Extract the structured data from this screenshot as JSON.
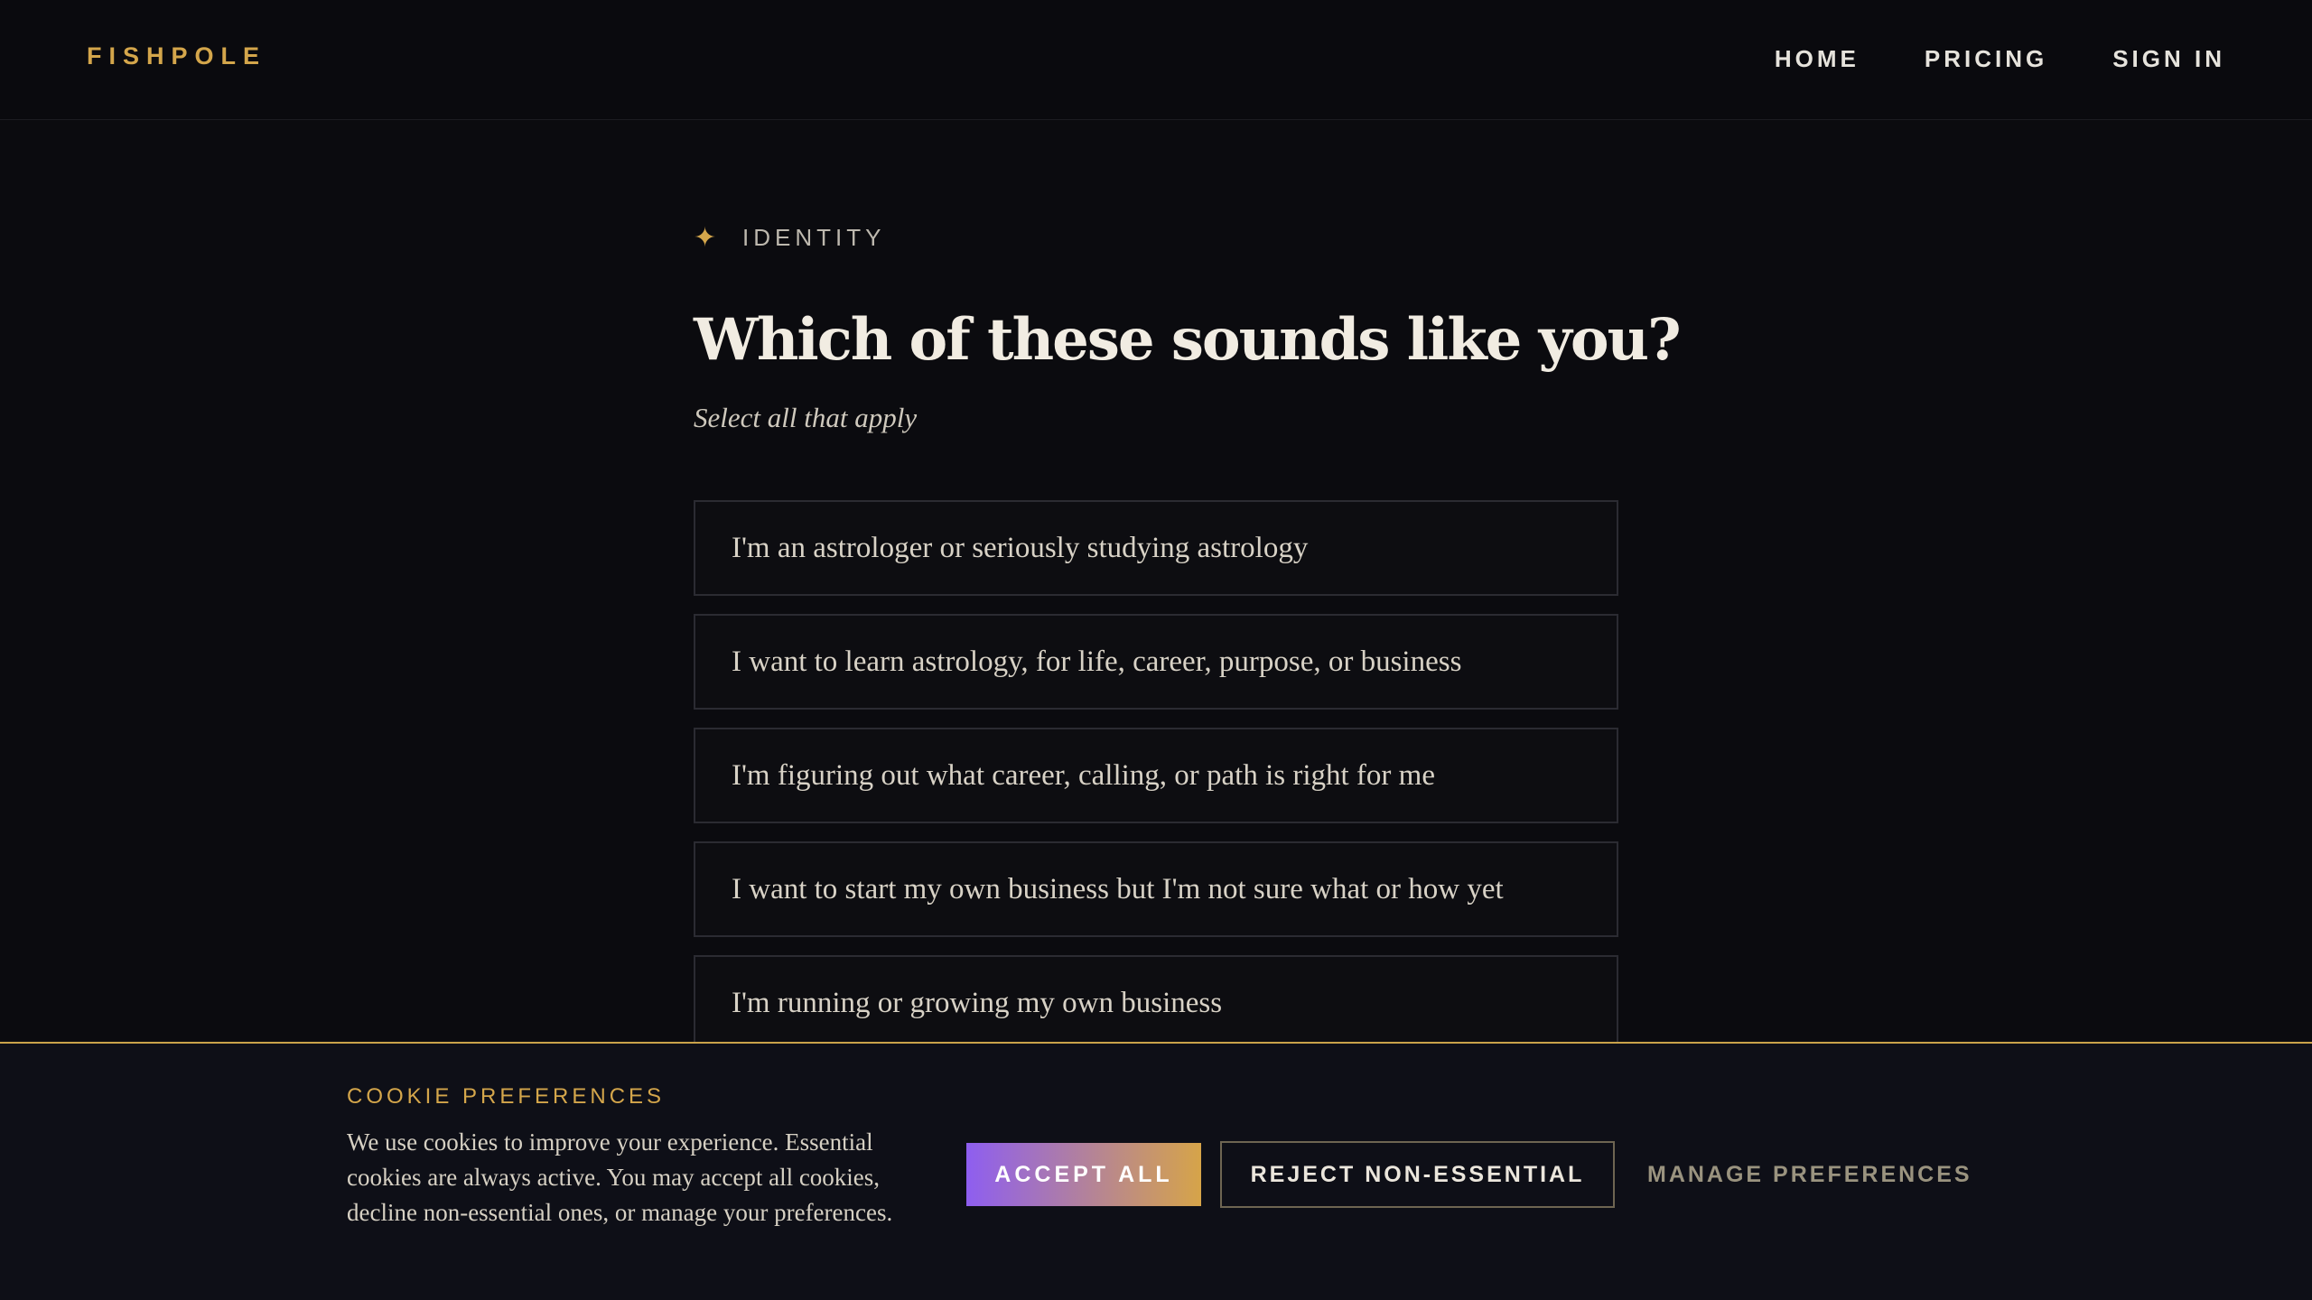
{
  "header": {
    "brand": "FISHPOLE",
    "nav": [
      "HOME",
      "PRICING",
      "SIGN IN"
    ]
  },
  "question": {
    "eyebrow_icon": "sparkle-star-icon",
    "eyebrow": "IDENTITY",
    "title": "Which of these sounds like you?",
    "subtitle": "Select all that apply",
    "options": [
      "I'm an astrologer or seriously studying astrology",
      "I want to learn astrology, for life, career, purpose, or business",
      "I'm figuring out what career, calling, or path is right for me",
      "I want to start my own business but I'm not sure what or how yet",
      "I'm running or growing my own business"
    ]
  },
  "cookie": {
    "title": "COOKIE PREFERENCES",
    "text": "We use cookies to improve your experience. Essential cookies are always active. You may accept all cookies, decline non-essential ones, or manage your preferences.",
    "accept": "ACCEPT ALL",
    "reject": "REJECT NON-ESSENTIAL",
    "manage": "MANAGE PREFERENCES"
  },
  "colors": {
    "accent_gold": "#d4a64b",
    "accent_purple": "#8e5ef0",
    "background": "#0b0b0f"
  }
}
